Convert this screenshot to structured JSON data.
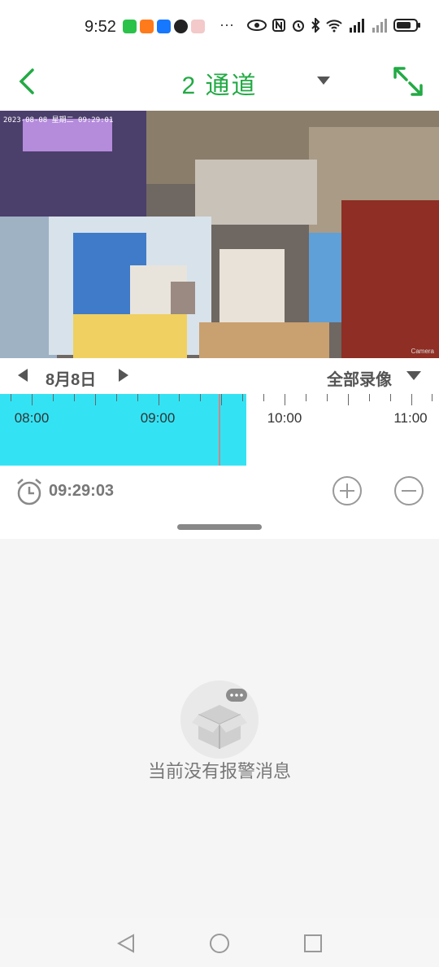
{
  "status_bar": {
    "time": "9:52",
    "more": "···"
  },
  "header": {
    "title": "2 通道"
  },
  "video": {
    "overlay_datetime": "2023-08-08  星期二  09:29:01",
    "overlay_corner": "Camera"
  },
  "date_nav": {
    "date": "8月8日",
    "filter": "全部录像"
  },
  "timeline": {
    "labels": [
      "08:00",
      "09:00",
      "10:00",
      "11:00"
    ],
    "recorded_until_fraction": 0.561,
    "cursor_fraction": 0.498,
    "record_color": "#33e3f4"
  },
  "controls": {
    "current_time": "09:29:03"
  },
  "alarm": {
    "empty_message": "当前没有报警消息"
  },
  "colors": {
    "accent": "#22aa44"
  }
}
